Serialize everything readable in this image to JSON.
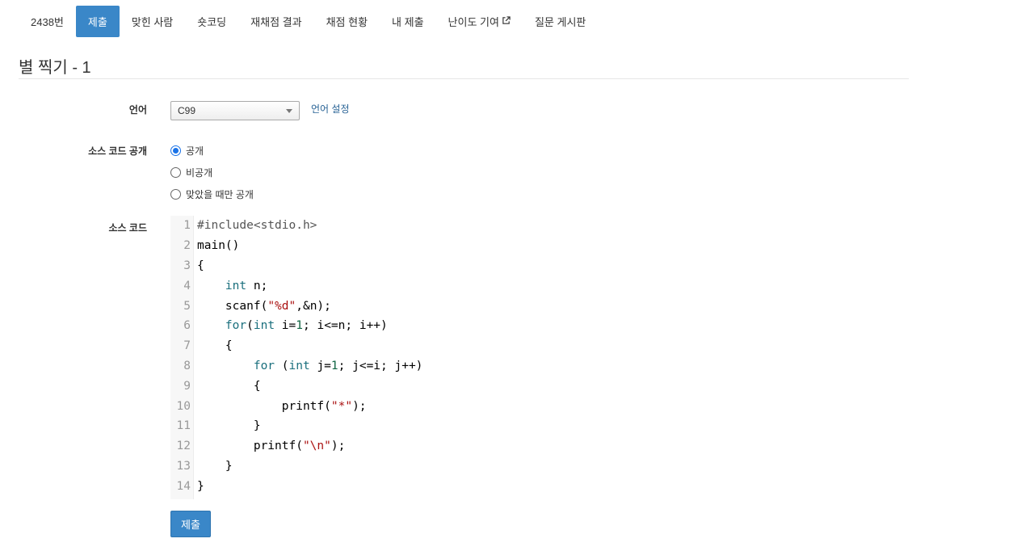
{
  "nav": {
    "items": [
      {
        "label": "2438번"
      },
      {
        "label": "제출",
        "active": true
      },
      {
        "label": "맞힌 사람"
      },
      {
        "label": "숏코딩"
      },
      {
        "label": "재채점 결과"
      },
      {
        "label": "채점 현황"
      },
      {
        "label": "내 제출"
      },
      {
        "label": "난이도 기여",
        "external": true
      },
      {
        "label": "질문 게시판"
      }
    ]
  },
  "problem": {
    "title": "별 찍기 - 1"
  },
  "form": {
    "language_label": "언어",
    "language_value": "C99",
    "language_setting_link": "언어 설정",
    "visibility_label": "소스 코드 공개",
    "visibility_options": [
      {
        "label": "공개",
        "checked": true
      },
      {
        "label": "비공개",
        "checked": false
      },
      {
        "label": "맞았을 때만 공개",
        "checked": false
      }
    ],
    "source_label": "소스 코드",
    "submit_label": "제출"
  },
  "code": {
    "lines": [
      {
        "no": "1",
        "text": "#include<stdio.h>"
      },
      {
        "no": "2",
        "text": "main()"
      },
      {
        "no": "3",
        "text": "{"
      },
      {
        "no": "4",
        "text": "    int n;"
      },
      {
        "no": "5",
        "text": "    scanf(\"%d\",&n);"
      },
      {
        "no": "6",
        "text": "    for(int i=1; i<=n; i++)"
      },
      {
        "no": "7",
        "text": "    {"
      },
      {
        "no": "8",
        "text": "        for (int j=1; j<=i; j++)"
      },
      {
        "no": "9",
        "text": "        {"
      },
      {
        "no": "10",
        "text": "            printf(\"*\");"
      },
      {
        "no": "11",
        "text": "        }"
      },
      {
        "no": "12",
        "text": "        printf(\"\\n\");"
      },
      {
        "no": "13",
        "text": "    }"
      },
      {
        "no": "14",
        "text": "}"
      }
    ]
  },
  "colors": {
    "accent": "#3a87c8",
    "link": "#2a6496",
    "keyword": "#1a6f7d",
    "string": "#aa1111"
  },
  "icons": {
    "external_link": "external-link-icon",
    "dropdown": "chevron-down-icon"
  }
}
